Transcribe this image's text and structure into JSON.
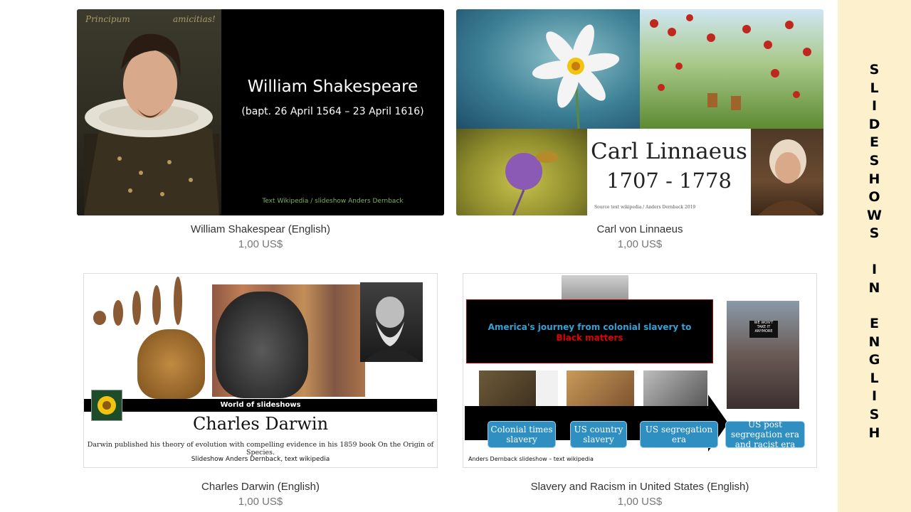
{
  "sidebar": {
    "word1": [
      "S",
      "L",
      "I",
      "D",
      "E",
      "S",
      "H",
      "O",
      "W",
      "S"
    ],
    "word2": [
      "I",
      "N"
    ],
    "word3": [
      "E",
      "N",
      "G",
      "L",
      "I",
      "S",
      "H"
    ]
  },
  "products": [
    {
      "caption": "William Shakespear (English)",
      "price": "1,00 US$",
      "slide": {
        "corner_left": "Principum",
        "corner_right": "amicitias!",
        "title": "William Shakespeare",
        "dates": "(bapt. 26 April 1564 – 23 April 1616)",
        "credit": "Text Wikipedia / slideshow Anders Dernback"
      }
    },
    {
      "caption": "Carl von Linnaeus",
      "price": "1,00 US$",
      "slide": {
        "name": "Carl Linnaeus",
        "years": "1707 - 1778",
        "source": "Source text wikipedia  / Anders Dernback 2019"
      }
    },
    {
      "caption": "Charles Darwin (English)",
      "price": "1,00 US$",
      "slide": {
        "band": "World of slideshows",
        "name": "Charles Darwin",
        "desc": "Darwin published his theory of evolution with compelling evidence in his 1859 book On the Origin of Species.",
        "credit": "Slideshow Anders Dernback, text wikipedia"
      }
    },
    {
      "caption": "Slavery and Racism in United States (English)",
      "price": "1,00 US$",
      "slide": {
        "banner_line1": "America's journey from colonial slavery to",
        "banner_line2": "Black matters",
        "sign": "WE WON'T TAKE IT ANYMORE",
        "stages": [
          "Colonial times slavery",
          "US country slavery",
          "US segregation era",
          "US post segregation era and racist era"
        ],
        "credit": "Anders Dernback slideshow – text wikipedia"
      }
    }
  ],
  "colors": {
    "sidebar_bg": "#fdf0cc",
    "stage_blue": "#2e8fc0",
    "banner_blue": "#36a0d6",
    "banner_red": "#e00000"
  }
}
